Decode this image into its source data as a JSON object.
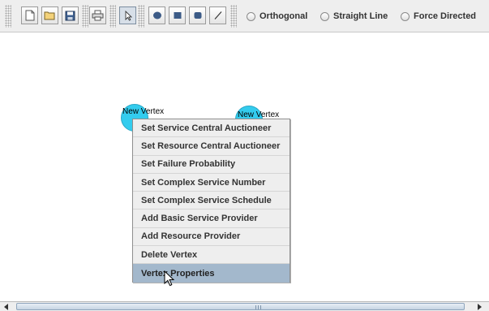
{
  "toolbar": {
    "file_buttons": [
      {
        "name": "new-document-icon"
      },
      {
        "name": "open-folder-icon"
      },
      {
        "name": "save-disk-icon"
      }
    ],
    "print_button": {
      "name": "printer-icon"
    },
    "select_tool": {
      "name": "select-arrow-icon",
      "selected": true
    },
    "shape_tools": [
      {
        "name": "ellipse-tool-icon"
      },
      {
        "name": "rectangle-tool-icon"
      },
      {
        "name": "rounded-rectangle-tool-icon"
      },
      {
        "name": "line-tool-icon"
      }
    ],
    "layout_options": [
      {
        "label": "Orthogonal",
        "selected": false
      },
      {
        "label": "Straight Line",
        "selected": false
      },
      {
        "label": "Force Directed",
        "selected": false
      }
    ]
  },
  "canvas": {
    "vertices": [
      {
        "label": "New Vertex"
      },
      {
        "label": "New Vertex"
      }
    ]
  },
  "context_menu": {
    "items": [
      "Set Service Central Auctioneer",
      "Set Resource Central Auctioneer",
      "Set Failure Probability",
      "Set Complex Service Number",
      "Set Complex Service Schedule",
      "Add Basic Service Provider",
      "Add Resource Provider",
      "Delete Vertex",
      "Vertex Properties"
    ],
    "highlighted_index": 8
  },
  "colors": {
    "vertex_fill": "#33ccee",
    "menu_highlight": "#a3b8cc",
    "toolbar_bg": "#eeeeee"
  }
}
